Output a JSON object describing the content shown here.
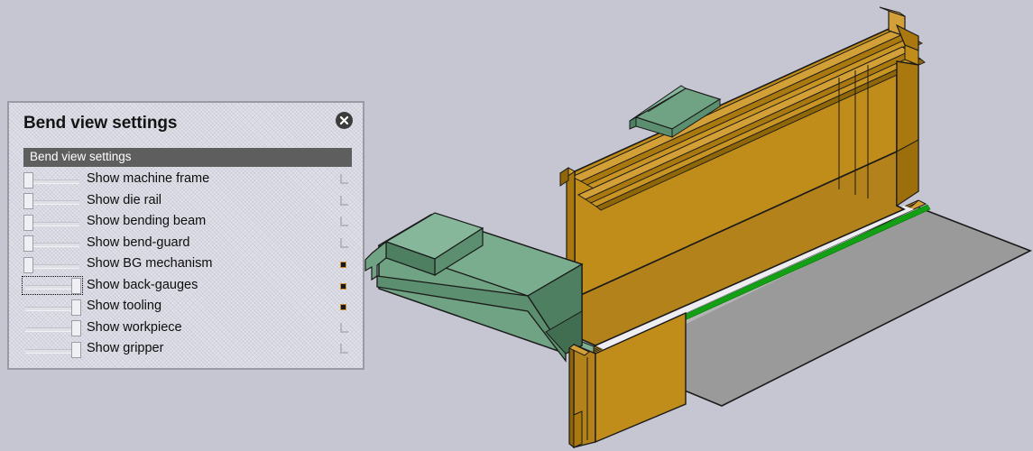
{
  "background": {
    "color": "#c6c6d2"
  },
  "dialog": {
    "title": "Bend view settings",
    "close_icon": "close-circle-icon",
    "section_header": "Bend view settings",
    "accent_header_color": "#5e5e5e",
    "rows": [
      {
        "label": "Show machine frame",
        "state": "off",
        "marker": "corner",
        "focused": false
      },
      {
        "label": "Show die rail",
        "state": "off",
        "marker": "corner",
        "focused": false
      },
      {
        "label": "Show bending beam",
        "state": "off",
        "marker": "corner",
        "focused": false
      },
      {
        "label": "Show bend-guard",
        "state": "off",
        "marker": "corner",
        "focused": false
      },
      {
        "label": "Show BG mechanism",
        "state": "off",
        "marker": "dot",
        "focused": false
      },
      {
        "label": "Show back-gauges",
        "state": "on",
        "marker": "dot",
        "focused": true
      },
      {
        "label": "Show tooling",
        "state": "on",
        "marker": "dot",
        "focused": false
      },
      {
        "label": "Show workpiece",
        "state": "on",
        "marker": "corner",
        "focused": false
      },
      {
        "label": "Show gripper",
        "state": "on",
        "marker": "corner",
        "focused": false
      }
    ]
  },
  "viewport": {
    "scene_name": "press-brake-bend-view",
    "parts": [
      {
        "name": "bending-beam",
        "color": "#c08c1a"
      },
      {
        "name": "back-gauge-arm",
        "color": "#6fa383"
      },
      {
        "name": "workpiece",
        "color": "#9a9a9a"
      },
      {
        "name": "die-rail-edge",
        "color": "#14a014"
      }
    ],
    "colors": {
      "machine_orange": "#c08c1a",
      "machine_orange_dark": "#a9780f",
      "machine_orange_light": "#d09c2c",
      "gauge_green": "#6fa383",
      "gauge_green_dark": "#5b8f6f",
      "gauge_green_light": "#87b79a",
      "workpiece_grey": "#9a9a9a",
      "workpiece_grey_light": "#ababab",
      "edge_green": "#14a014",
      "outline": "#1a1a1a"
    }
  }
}
